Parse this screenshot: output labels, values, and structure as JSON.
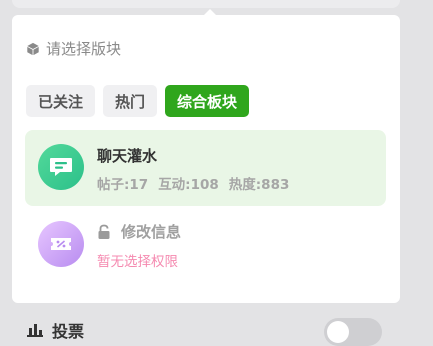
{
  "panel": {
    "title": "请选择版块",
    "title_icon": "cube-icon"
  },
  "tabs": [
    {
      "label": "已关注",
      "active": false
    },
    {
      "label": "热门",
      "active": false
    },
    {
      "label": "综合板块",
      "active": true
    }
  ],
  "boards": [
    {
      "name": "聊天灌水",
      "icon": "chat-bubble-icon",
      "stats": [
        "帖子:17",
        "互动:108",
        "热度:883"
      ],
      "selected": true
    },
    {
      "name": "修改信息",
      "icon": "ticket-percent-icon",
      "locked": true,
      "note": "暂无选择权限"
    }
  ],
  "bottom": {
    "label": "投票",
    "icon": "bar-chart-icon",
    "toggle_on": false
  },
  "colors": {
    "accent": "#2fa61c",
    "selected_bg": "#e9f6e6",
    "warning_text": "#f58ab0"
  }
}
